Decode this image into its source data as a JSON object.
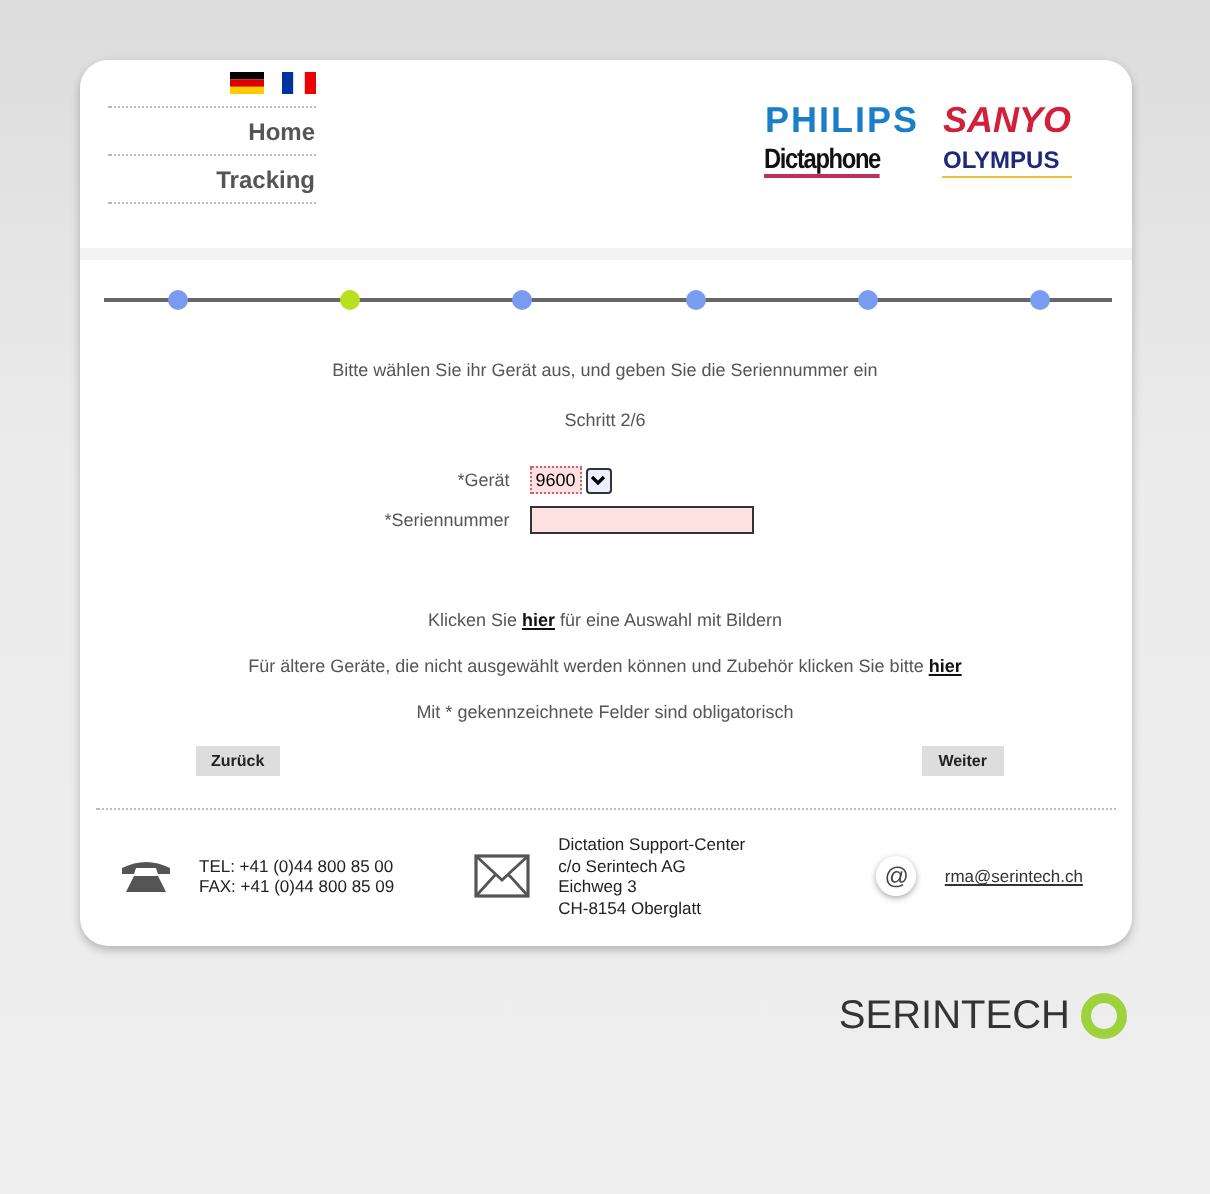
{
  "languages": [
    {
      "kind": "de"
    },
    {
      "kind": "fr"
    }
  ],
  "nav": [
    "Home",
    "Tracking"
  ],
  "logos": {
    "philips": "PHILIPS",
    "dictaphone": "Dictaphone",
    "sanyo": "SANYO",
    "olympus": "OLYMPUS"
  },
  "steps": [
    {
      "selected": false
    },
    {
      "selected": true
    },
    {
      "selected": false
    },
    {
      "selected": false
    },
    {
      "selected": false
    },
    {
      "selected": false
    }
  ],
  "intro": "Bitte wählen Sie ihr Gerät aus, und geben Sie die Seriennummer ein",
  "step_label": "Schritt 2/6",
  "fields": [
    {
      "kind": "select",
      "label": "*Gerät",
      "value": "9600"
    },
    {
      "kind": "text",
      "label": "*Seriennummer"
    }
  ],
  "links": [
    {
      "before": "Klicken Sie",
      "link": "hier",
      "after": "für eine Auswahl mit Bildern"
    },
    {
      "before": "Für ältere Geräte, die nicht ausgewählt werden können und Zubehör klicken Sie bitte",
      "link": "hier"
    }
  ],
  "note": "Mit * gekennzeichnete Felder sind obligatorisch",
  "buttons": {
    "back": "Zurück",
    "next": "Weiter"
  },
  "footer": {
    "phone": [
      "TEL: +41 (0)44 800 85 00",
      "FAX: +41 (0)44 800 85 09"
    ],
    "address": [
      "Dictation Support-Center",
      "c/o Serintech AG",
      "Eichweg 3",
      "CH-8154 Oberglatt"
    ],
    "at_symbol": "@",
    "email": "rma@serintech.ch"
  },
  "brand": "SERINTECH"
}
